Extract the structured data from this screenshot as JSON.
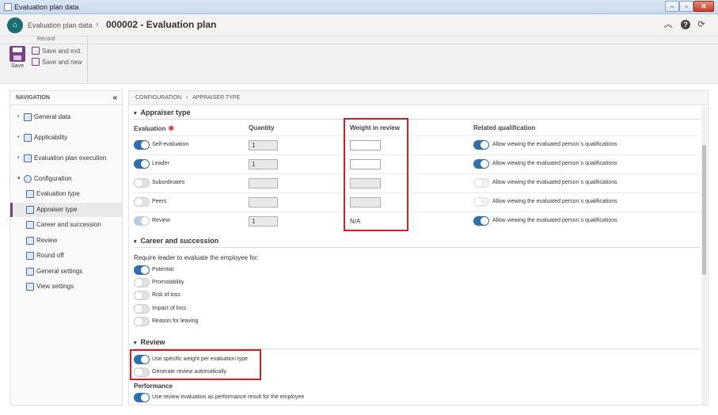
{
  "window": {
    "title": "Evaluation plan data",
    "min": "0",
    "max": "1",
    "close": "r"
  },
  "header": {
    "app_label": "Evaluation plan data",
    "separator": "›",
    "record_title": "000002 - Evaluation plan",
    "collapse_icon": "«",
    "help_icon": "?",
    "refresh_icon": "⟳"
  },
  "ribbon": {
    "group_title": "Record",
    "save_label": "Save",
    "save_exit_label": "Save and exit",
    "save_new_label": "Save and new"
  },
  "navigation": {
    "title": "NAVIGATION",
    "collapse": "«",
    "items": [
      {
        "label": "General data",
        "bullet": "•"
      },
      {
        "label": "Applicability",
        "bullet": "•"
      },
      {
        "label": "Evaluation plan execution",
        "bullet": "•"
      },
      {
        "label": "Configuration",
        "bullet": "▾"
      },
      {
        "label": "Evaluation type"
      },
      {
        "label": "Appraiser type"
      },
      {
        "label": "Career and succession"
      },
      {
        "label": "Review"
      },
      {
        "label": "Round off"
      },
      {
        "label": "General settings"
      },
      {
        "label": "View settings"
      }
    ]
  },
  "breadcrumb": {
    "parent": "CONFIGURATION",
    "sep": "›",
    "current": "APPRAISER TYPE"
  },
  "appraiser": {
    "title": "Appraiser type",
    "caret": "▾",
    "columns": {
      "evaluation": "Evaluation",
      "required": "✱",
      "quantity": "Quantity",
      "weight": "Weight in review",
      "related": "Related qualification"
    },
    "rows": [
      {
        "label": "Self-evaluation",
        "quantity": "1",
        "weight": "",
        "related": "Allow viewing the evaluated person`s qualifications"
      },
      {
        "label": "Leader",
        "quantity": "1",
        "weight": "",
        "related": "Allow viewing the evaluated person`s qualifications"
      },
      {
        "label": "Subordinates",
        "quantity": "",
        "weight": "",
        "related": "Allow viewing the evaluated person`s qualifications"
      },
      {
        "label": "Peers",
        "quantity": "",
        "weight": "",
        "related": "Allow viewing the evaluated person`s qualifications"
      },
      {
        "label": "Review",
        "quantity": "1",
        "weight": "N/A",
        "related": "Allow viewing the evaluated person`s qualifications"
      }
    ]
  },
  "career": {
    "title": "Career and succession",
    "caret": "▾",
    "subtitle": "Require leader to evaluate the employee for:",
    "options": [
      {
        "label": "Potential"
      },
      {
        "label": "Promotability"
      },
      {
        "label": "Risk of loss"
      },
      {
        "label": "Impact of loss"
      },
      {
        "label": "Reason for leaving"
      }
    ]
  },
  "review": {
    "title": "Review",
    "caret": "▾",
    "options": [
      {
        "label": "Use specific weight per evaluation type"
      },
      {
        "label": "Generate review automatically"
      }
    ],
    "performance_title": "Performance",
    "performance_option": "Use review evaluation as performance result for the employee"
  },
  "colors": {
    "accent": "#2f6fad",
    "brand": "#7b3f87",
    "highlight": "#d21f1f",
    "logo": "#1b6e74"
  }
}
